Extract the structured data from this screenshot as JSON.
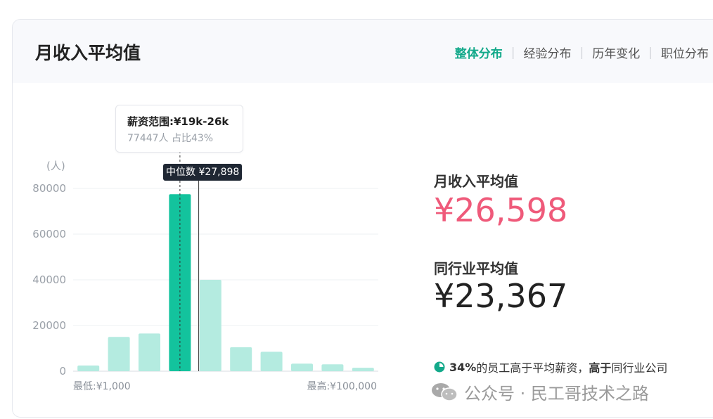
{
  "title": "月收入平均值",
  "tabs": [
    {
      "label": "整体分布",
      "active": true
    },
    {
      "label": "经验分布",
      "active": false
    },
    {
      "label": "历年变化",
      "active": false
    },
    {
      "label": "职位分布",
      "active": false
    }
  ],
  "tooltip": {
    "title": "薪资范围:¥19k-26k",
    "subtitle": "77447人  占比43%"
  },
  "median_label": "中位数 ¥27,898",
  "stats": {
    "avg_label": "月收入平均值",
    "avg_value": "¥26,598",
    "industry_label": "同行业平均值",
    "industry_value": "¥23,367"
  },
  "note": {
    "pct": "34%",
    "mid": "的员工高于平均薪资，",
    "bold": "高于",
    "tail": "同行业公司"
  },
  "watermark": "公众号 · 民工哥技术之路",
  "colors": {
    "bar": "#b4ebe0",
    "bar_active": "#13c39d",
    "accent": "#13a98a",
    "avg": "#ef5a7a"
  },
  "chart_data": {
    "type": "bar",
    "y_unit": "(人)",
    "y_ticks": [
      0,
      20000,
      40000,
      60000,
      80000
    ],
    "ylim": [
      0,
      80000
    ],
    "x_start_label": "最低:¥1,000",
    "x_end_label": "最高:¥100,000",
    "values": [
      2500,
      15000,
      16500,
      77447,
      40000,
      10500,
      8500,
      3300,
      3000,
      1500
    ],
    "highlight_index": 3,
    "median_position_between": 4
  }
}
